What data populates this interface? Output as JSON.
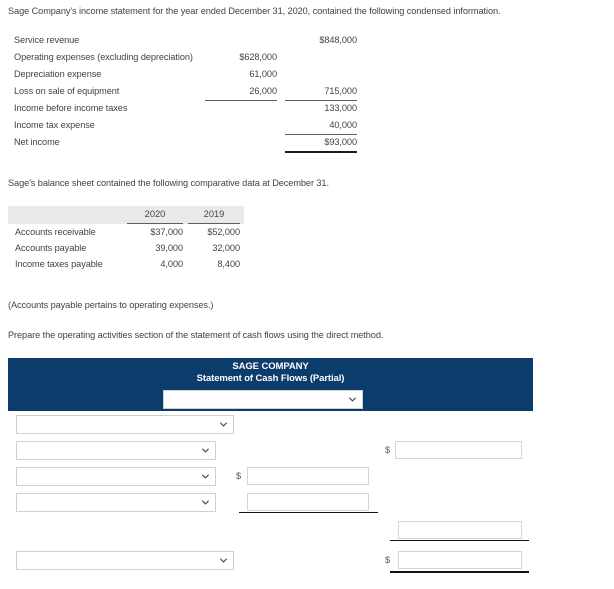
{
  "intro": {
    "line1": "Sage Company's income statement for the year ended December 31, 2020, contained the following condensed information.",
    "balance_sheet_lead": "Sage's balance sheet contained the following comparative data at December 31.",
    "note": "(Accounts payable pertains to operating expenses.)",
    "instruction": "Prepare the operating activities section of the statement of cash flows using the direct method."
  },
  "income_statement": {
    "rows": [
      {
        "label": "Service revenue",
        "col1": "",
        "col2": "$848,000"
      },
      {
        "label": "Operating expenses (excluding depreciation)",
        "col1": "$628,000",
        "col2": ""
      },
      {
        "label": "Depreciation expense",
        "col1": "61,000",
        "col2": ""
      },
      {
        "label": "Loss on sale of equipment",
        "col1": "26,000",
        "col2": "715,000"
      },
      {
        "label": "Income before income taxes",
        "col1": "",
        "col2": "133,000"
      },
      {
        "label": "Income tax expense",
        "col1": "",
        "col2": "40,000"
      },
      {
        "label": "Net income",
        "col1": "",
        "col2": "$93,000"
      }
    ]
  },
  "balance_sheet": {
    "columns": [
      "",
      "2020",
      "2019"
    ],
    "rows": [
      {
        "name": "Accounts receivable",
        "v2020": "$37,000",
        "v2019": "$52,000"
      },
      {
        "name": "Accounts payable",
        "v2020": "39,000",
        "v2019": "32,000"
      },
      {
        "name": "Income taxes payable",
        "v2020": "4,000",
        "v2019": "8,400"
      }
    ]
  },
  "statement": {
    "company": "SAGE COMPANY",
    "title": "Statement of Cash Flows (Partial)",
    "header_select": {
      "value": "",
      "placeholder": ""
    },
    "rows": [
      {
        "select": "",
        "mid_dollar": "",
        "mid_value": "",
        "right_dollar": "",
        "right_value": ""
      },
      {
        "select": "",
        "mid_dollar": "",
        "mid_value": "",
        "right_dollar": "$",
        "right_value": ""
      },
      {
        "select": "",
        "mid_dollar": "$",
        "mid_value": "",
        "right_dollar": "",
        "right_value": ""
      },
      {
        "select": "",
        "mid_dollar": "",
        "mid_value": "",
        "right_dollar": "",
        "right_value": ""
      },
      {
        "select": "",
        "mid_dollar": "",
        "mid_value": "",
        "right_dollar": "",
        "right_value": ""
      },
      {
        "select": "",
        "mid_dollar": "",
        "mid_value": "",
        "right_dollar": "$",
        "right_value": ""
      }
    ],
    "dollar_sign": "$"
  },
  "colors": {
    "header_blue": "#0c3c6b",
    "table_header_gray": "#e9e9e9",
    "text": "#3f4448",
    "rule": "#111111"
  }
}
